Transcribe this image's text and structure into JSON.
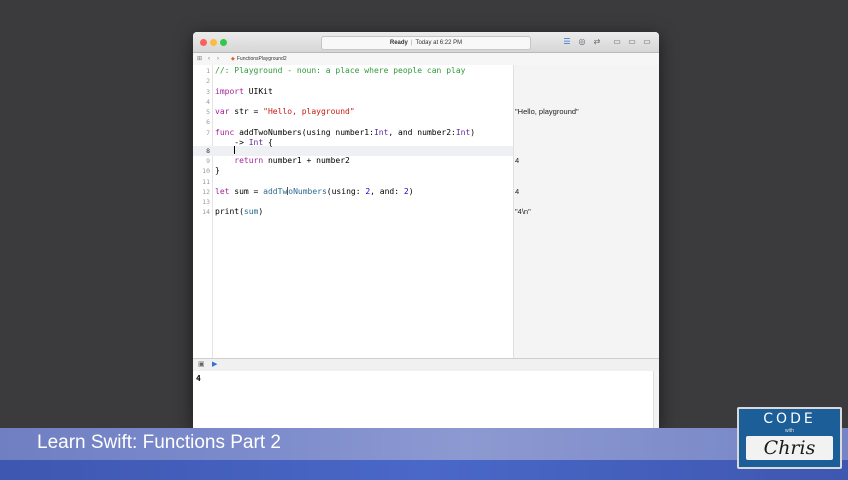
{
  "window": {
    "status": "Ready",
    "timestamp": "Today at 6:22 PM",
    "file_name": "FunctionsPlayground2"
  },
  "editor": {
    "lines": [
      {
        "n": "1"
      },
      {
        "n": "2"
      },
      {
        "n": "3"
      },
      {
        "n": "4"
      },
      {
        "n": "5"
      },
      {
        "n": "6"
      },
      {
        "n": "7"
      },
      {
        "n": ""
      },
      {
        "n": "8"
      },
      {
        "n": "9"
      },
      {
        "n": "10"
      },
      {
        "n": "11"
      },
      {
        "n": "12"
      },
      {
        "n": "13"
      },
      {
        "n": "14"
      }
    ],
    "code": {
      "l1_comment": "//: Playground - noun: a place where people can play",
      "l3_kw": "import",
      "l3_mod": " UIKit",
      "l5_kw": "var",
      "l5_rest": " str = ",
      "l5_str": "\"Hello, playground\"",
      "l7_kw": "func",
      "l7_a": " addTwoNumbers(using number1:",
      "l7_t1": "Int",
      "l7_b": ", and number2:",
      "l7_t2": "Int",
      "l7_c": ")",
      "l7w_a": "    -> ",
      "l7w_t": "Int",
      "l7w_b": " {",
      "l8_indent": "    ",
      "l9_indent": "    ",
      "l9_kw": "return",
      "l9_rest": " number1 + number2",
      "l10": "}",
      "l12_kw": "let",
      "l12_a": " sum = ",
      "l12_fn1": "addTw",
      "l12_fn2": "oNumbers",
      "l12_b": "(using: ",
      "l12_n1": "2",
      "l12_c": ", and: ",
      "l12_n2": "2",
      "l12_d": ")",
      "l14_fn": "print",
      "l14_a": "(",
      "l14_var": "sum",
      "l14_b": ")"
    },
    "results": {
      "r5": "\"Hello, playground\"",
      "r9": "4",
      "r12": "4",
      "r14": "\"4\\n\""
    }
  },
  "console": {
    "output": "4"
  },
  "banner": {
    "title": "Learn Swift: Functions Part 2"
  },
  "badge": {
    "top": "CODE",
    "with": "with",
    "bottom": "Chris"
  },
  "icons": {
    "play": "▶",
    "grid": "⊞",
    "back": "‹",
    "forward": "›"
  }
}
